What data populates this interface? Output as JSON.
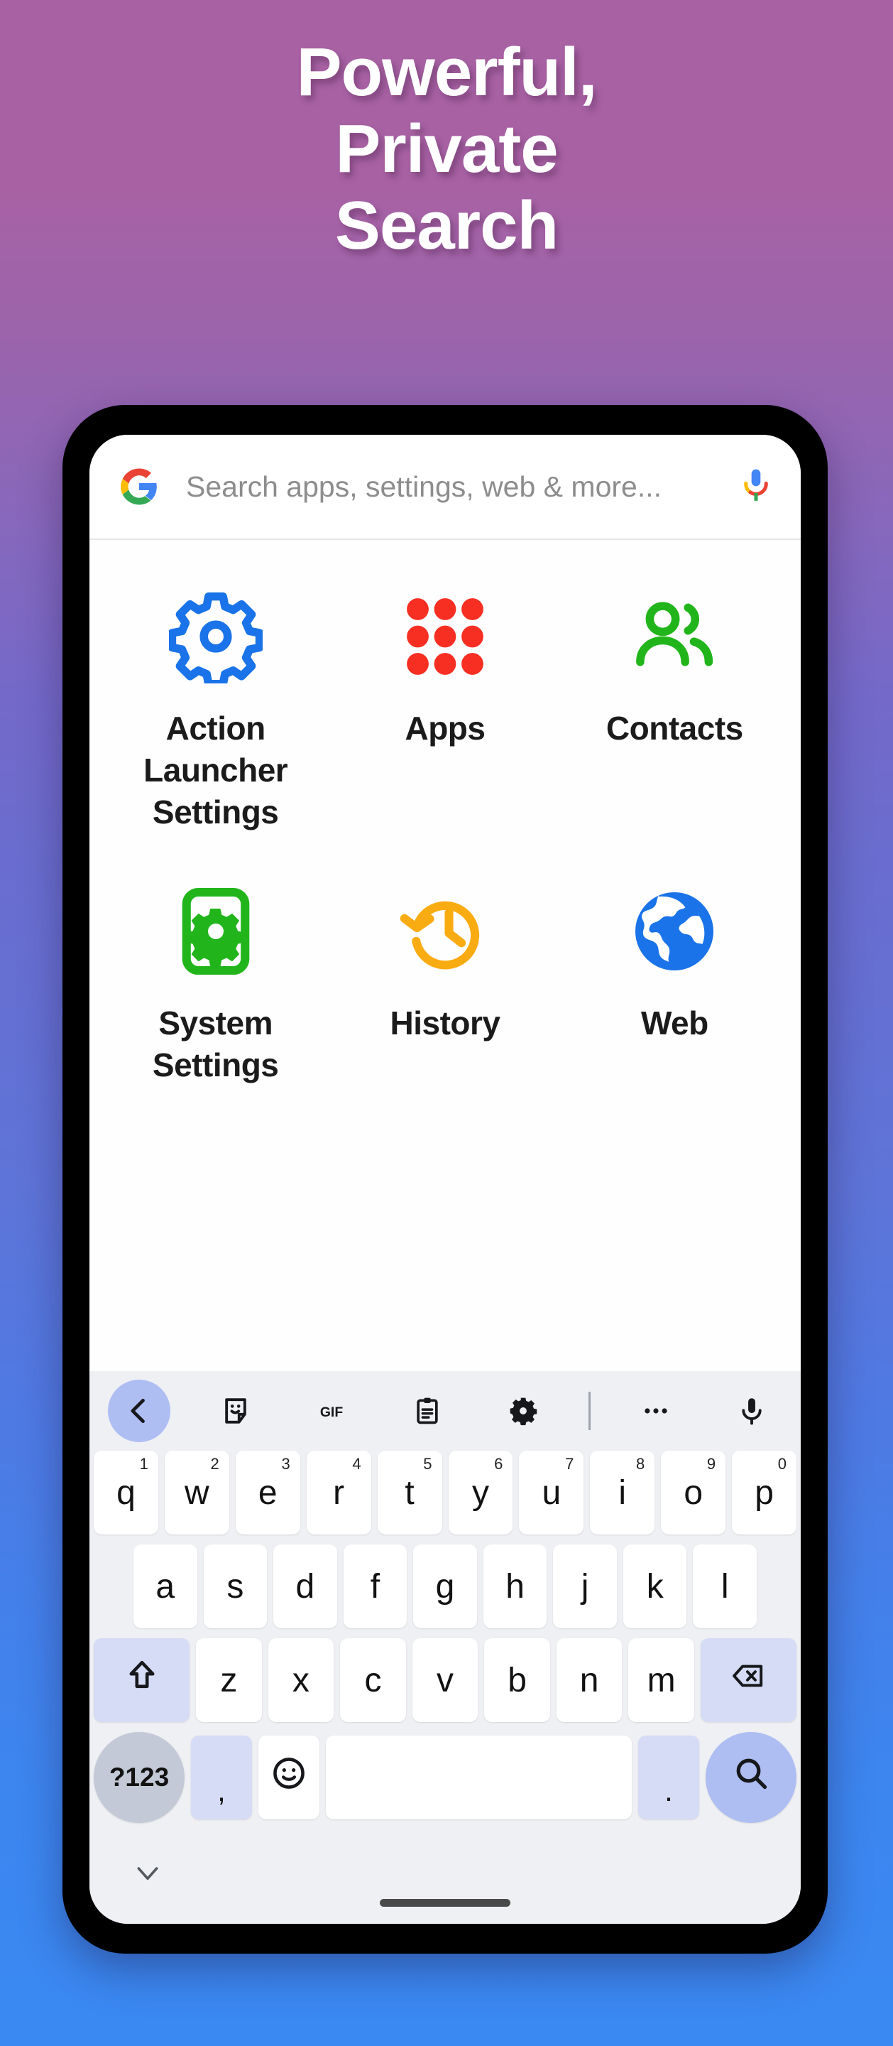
{
  "headline": {
    "lines": [
      "Powerful,",
      "Private",
      "Search"
    ]
  },
  "colors": {
    "gradient_top": "#a862a4",
    "gradient_mid": "#6470d3",
    "gradient_bottom": "#3a89f2",
    "phone_frame": "#000000",
    "keyboard_bg": "#eff0f4",
    "key_bg": "#ffffff",
    "mod_key_bg": "#d6dcf5",
    "sym_key_bg": "#c3c9d6",
    "enter_key_bg": "#aebef3",
    "accent_blue": "#1a73e8",
    "accent_green": "#21b51b",
    "accent_red": "#f72f23",
    "accent_amber": "#f9ab12"
  },
  "search": {
    "logo_icon": "google-g-icon",
    "placeholder": "Search apps, settings, web & more...",
    "value": "",
    "mic_icon": "google-mic-icon"
  },
  "results": [
    {
      "label": "Action Launcher Settings",
      "icon": "gear-outline-icon",
      "color": "#1a73e8"
    },
    {
      "label": "Apps",
      "icon": "apps-grid-icon",
      "color": "#f72f23"
    },
    {
      "label": "Contacts",
      "icon": "people-icon",
      "color": "#21b51b"
    },
    {
      "label": "System Settings",
      "icon": "phone-gear-icon",
      "color": "#21b51b"
    },
    {
      "label": "History",
      "icon": "history-clock-icon",
      "color": "#f9ab12"
    },
    {
      "label": "Web",
      "icon": "globe-icon",
      "color": "#1a73e8"
    }
  ],
  "keyboard": {
    "toolbar": [
      {
        "name": "back-chevron-icon",
        "label": ""
      },
      {
        "name": "sticker-icon",
        "label": ""
      },
      {
        "name": "gif-icon",
        "label": "GIF"
      },
      {
        "name": "clipboard-icon",
        "label": ""
      },
      {
        "name": "gear-icon",
        "label": ""
      },
      {
        "name": "divider",
        "label": ""
      },
      {
        "name": "more-options-icon",
        "label": ""
      },
      {
        "name": "microphone-icon",
        "label": ""
      }
    ],
    "row1": [
      {
        "key": "q",
        "num": "1"
      },
      {
        "key": "w",
        "num": "2"
      },
      {
        "key": "e",
        "num": "3"
      },
      {
        "key": "r",
        "num": "4"
      },
      {
        "key": "t",
        "num": "5"
      },
      {
        "key": "y",
        "num": "6"
      },
      {
        "key": "u",
        "num": "7"
      },
      {
        "key": "i",
        "num": "8"
      },
      {
        "key": "o",
        "num": "9"
      },
      {
        "key": "p",
        "num": "0"
      }
    ],
    "row2": [
      {
        "key": "a"
      },
      {
        "key": "s"
      },
      {
        "key": "d"
      },
      {
        "key": "f"
      },
      {
        "key": "g"
      },
      {
        "key": "h"
      },
      {
        "key": "j"
      },
      {
        "key": "k"
      },
      {
        "key": "l"
      }
    ],
    "row3": [
      {
        "key": "z"
      },
      {
        "key": "x"
      },
      {
        "key": "c"
      },
      {
        "key": "v"
      },
      {
        "key": "b"
      },
      {
        "key": "n"
      },
      {
        "key": "m"
      }
    ],
    "shift_label": "shift-icon",
    "backspace_label": "backspace-icon",
    "symbols_label": "?123",
    "comma_label": ",",
    "emoji_label": "emoji-icon",
    "space_label": "",
    "period_label": ".",
    "enter_label": "search-icon"
  },
  "navbar": {
    "hide_keyboard_icon": "chevron-down-icon",
    "home_indicator": "home-indicator"
  }
}
